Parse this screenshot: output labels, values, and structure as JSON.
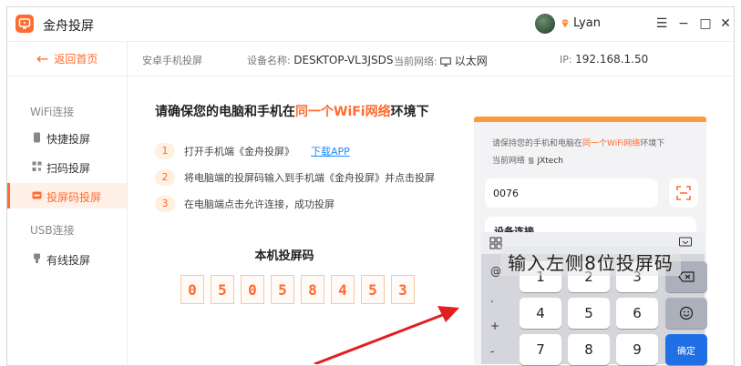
{
  "window": {
    "app_name": "金舟投屏",
    "username": "Lyan",
    "controls": {
      "menu": "☰",
      "minimize": "−",
      "maximize": "□",
      "close": "✕"
    }
  },
  "toolbar": {
    "back_label": "返回首页",
    "mode": "安卓手机投屏",
    "device_label": "设备名称:",
    "device_value": "DESKTOP-VL3JSDS",
    "network_label": "当前网络:",
    "network_value": "以太网",
    "ip_label": "IP:",
    "ip_value": "192.168.1.50"
  },
  "sidebar": {
    "wifi_header": "WiFi连接",
    "items": [
      {
        "label": "快捷投屏",
        "icon": "phone-icon"
      },
      {
        "label": "扫码投屏",
        "icon": "qrcode-icon"
      },
      {
        "label": "投屏码投屏",
        "icon": "code-icon",
        "active": true
      }
    ],
    "usb_header": "USB连接",
    "usb_items": [
      {
        "label": "有线投屏",
        "icon": "usb-icon"
      }
    ]
  },
  "main": {
    "title_prefix": "请确保您的电脑和手机在",
    "title_highlight": "同一个WiFi网络",
    "title_suffix": "环境下",
    "steps": [
      {
        "num": "1",
        "text": "打开手机端《金舟投屏》",
        "link": "下载APP"
      },
      {
        "num": "2",
        "text": "将电脑端的投屏码输入到手机端《金舟投屏》并点击投屏"
      },
      {
        "num": "3",
        "text": "在电脑端点击允许连接，成功投屏"
      }
    ],
    "code_label": "本机投屏码",
    "code_digits": [
      "0",
      "5",
      "0",
      "5",
      "8",
      "4",
      "5",
      "3"
    ]
  },
  "phone": {
    "hint_prefix": "请保持您的手机和电脑在",
    "hint_highlight": "同一个WiFi网络",
    "hint_suffix": "环境下",
    "network_label": "当前网络",
    "network_value": "JXtech",
    "input_value": "0076",
    "connect_label": "设备连接",
    "overlay_text": "输入左侧8位投屏码",
    "keyboard": {
      "side_keys": [
        "@",
        ".",
        "+",
        "-"
      ],
      "rows": [
        [
          "1",
          "2",
          "3"
        ],
        [
          "4",
          "5",
          "6"
        ],
        [
          "7",
          "8",
          "9"
        ]
      ],
      "enter_label": "确定"
    }
  },
  "colors": {
    "accent": "#ff6a2e",
    "link": "#1a8cff",
    "arrow": "#e02020"
  }
}
